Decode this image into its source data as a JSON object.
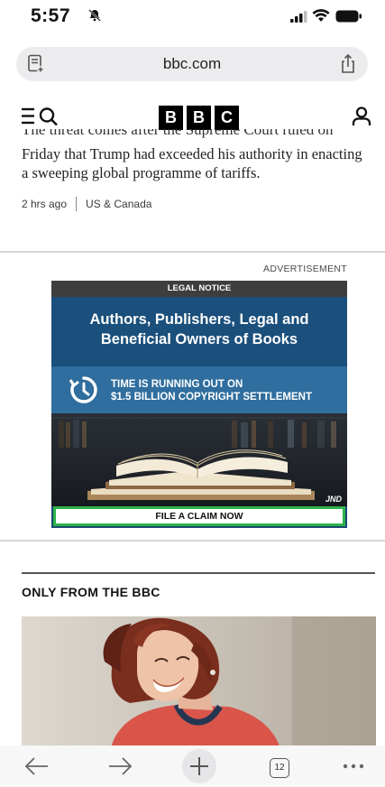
{
  "status_bar": {
    "time": "5:57"
  },
  "browser": {
    "url": "bbc.com",
    "tab_count": "12"
  },
  "bbc_header": {
    "logo_letters": [
      "B",
      "B",
      "C"
    ]
  },
  "article": {
    "cut_line": "The threat comes after the Supreme Court ruled on",
    "summary": "Friday that Trump had exceeded his authority in enacting a sweeping global programme of tariffs.",
    "time_ago": "2 hrs ago",
    "category": "US & Canada"
  },
  "ad": {
    "label": "ADVERTISEMENT",
    "legal_notice": "LEGAL NOTICE",
    "headline_line1": "Authors, Publishers, Legal and",
    "headline_line2": "Beneficial Owners of Books",
    "time_line1": "TIME IS RUNNING OUT ON",
    "time_line2": "$1.5 BILLION COPYRIGHT SETTLEMENT",
    "watermark": "JND",
    "cta": "FILE A CLAIM NOW"
  },
  "section": {
    "title": "ONLY FROM THE BBC"
  },
  "icons": {
    "bell": "bell-slash-icon",
    "menu": "menu-search-icon",
    "account": "account-icon",
    "reader": "reader-mode-icon",
    "share": "share-icon",
    "back": "back-arrow-icon",
    "forward": "forward-arrow-icon",
    "new_tab": "plus-icon",
    "tabs": "tabs-icon",
    "more": "more-icon",
    "clock": "clock-icon"
  },
  "colors": {
    "ad_blue": "#1b4f7c",
    "ad_mid_blue": "#2f6e9e",
    "cta_green": "#2db34a"
  }
}
